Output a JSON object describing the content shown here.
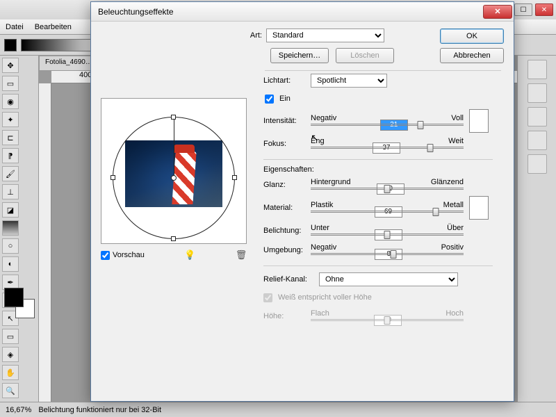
{
  "app": {
    "menu": {
      "file": "Datei",
      "edit": "Bearbeiten"
    },
    "tab": "Fotolia_4690…",
    "ruler_mark": "400",
    "zoom": "16,67%",
    "status": "Belichtung funktioniert nur bei 32-Bit"
  },
  "dialog": {
    "title": "Beleuchtungseffekte",
    "ok": "OK",
    "cancel": "Abbrechen",
    "art_label": "Art:",
    "art_value": "Standard",
    "save": "Speichern…",
    "delete": "Löschen",
    "lichtart_label": "Lichtart:",
    "lichtart_value": "Spotlicht",
    "ein": "Ein",
    "intensity": {
      "label": "Intensität:",
      "left": "Negativ",
      "right": "Voll",
      "value": "21",
      "pos": 72
    },
    "focus": {
      "label": "Fokus:",
      "left": "Eng",
      "right": "Weit",
      "value": "37",
      "pos": 78
    },
    "props_label": "Eigenschaften:",
    "gloss": {
      "label": "Glanz:",
      "left": "Hintergrund",
      "right": "Glänzend",
      "value": "0",
      "pos": 50
    },
    "material": {
      "label": "Material:",
      "left": "Plastik",
      "right": "Metall",
      "value": "69",
      "pos": 82
    },
    "exposure": {
      "label": "Belichtung:",
      "left": "Unter",
      "right": "Über",
      "value": "0",
      "pos": 50
    },
    "ambience": {
      "label": "Umgebung:",
      "left": "Negativ",
      "right": "Positiv",
      "value": "8",
      "pos": 54
    },
    "relief_label": "Relief-Kanal:",
    "relief_value": "Ohne",
    "white_label": "Weiß entspricht voller Höhe",
    "height": {
      "label": "Höhe:",
      "left": "Flach",
      "right": "Hoch",
      "value": "50",
      "pos": 50
    },
    "preview_label": "Vorschau"
  }
}
